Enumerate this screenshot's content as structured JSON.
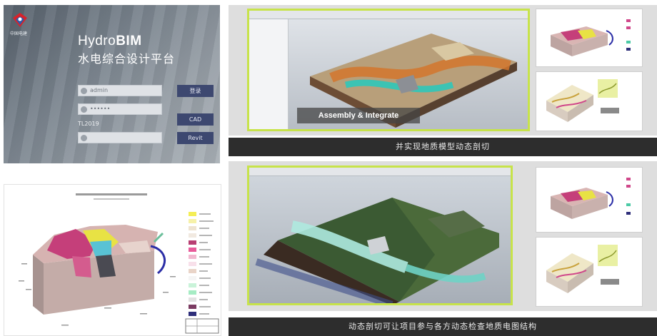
{
  "login": {
    "logo_text": "中国电建",
    "brand_prefix": "Hydro",
    "brand_bold": "BIM",
    "subtitle": "水电综合设计平台",
    "username_value": "admin",
    "password_value": "••••••",
    "extra_label": "TL2019",
    "btn_login": "登录",
    "btn_cad": "CAD",
    "btn_revit": "Revit",
    "colors": {
      "button": "#3d4870",
      "accent_red": "#d8232a",
      "accent_blue": "#2f5aa8"
    }
  },
  "top_video": {
    "overlay_text": "Assembly & Integrate",
    "caption": "并实现地质模型动态剖切"
  },
  "bottom_video": {
    "caption": "动态剖切可让项目参与各方动态检查地质电图结构"
  },
  "icons": {
    "logo": "company-logo-icon",
    "user": "user-icon",
    "lock": "lock-icon"
  }
}
